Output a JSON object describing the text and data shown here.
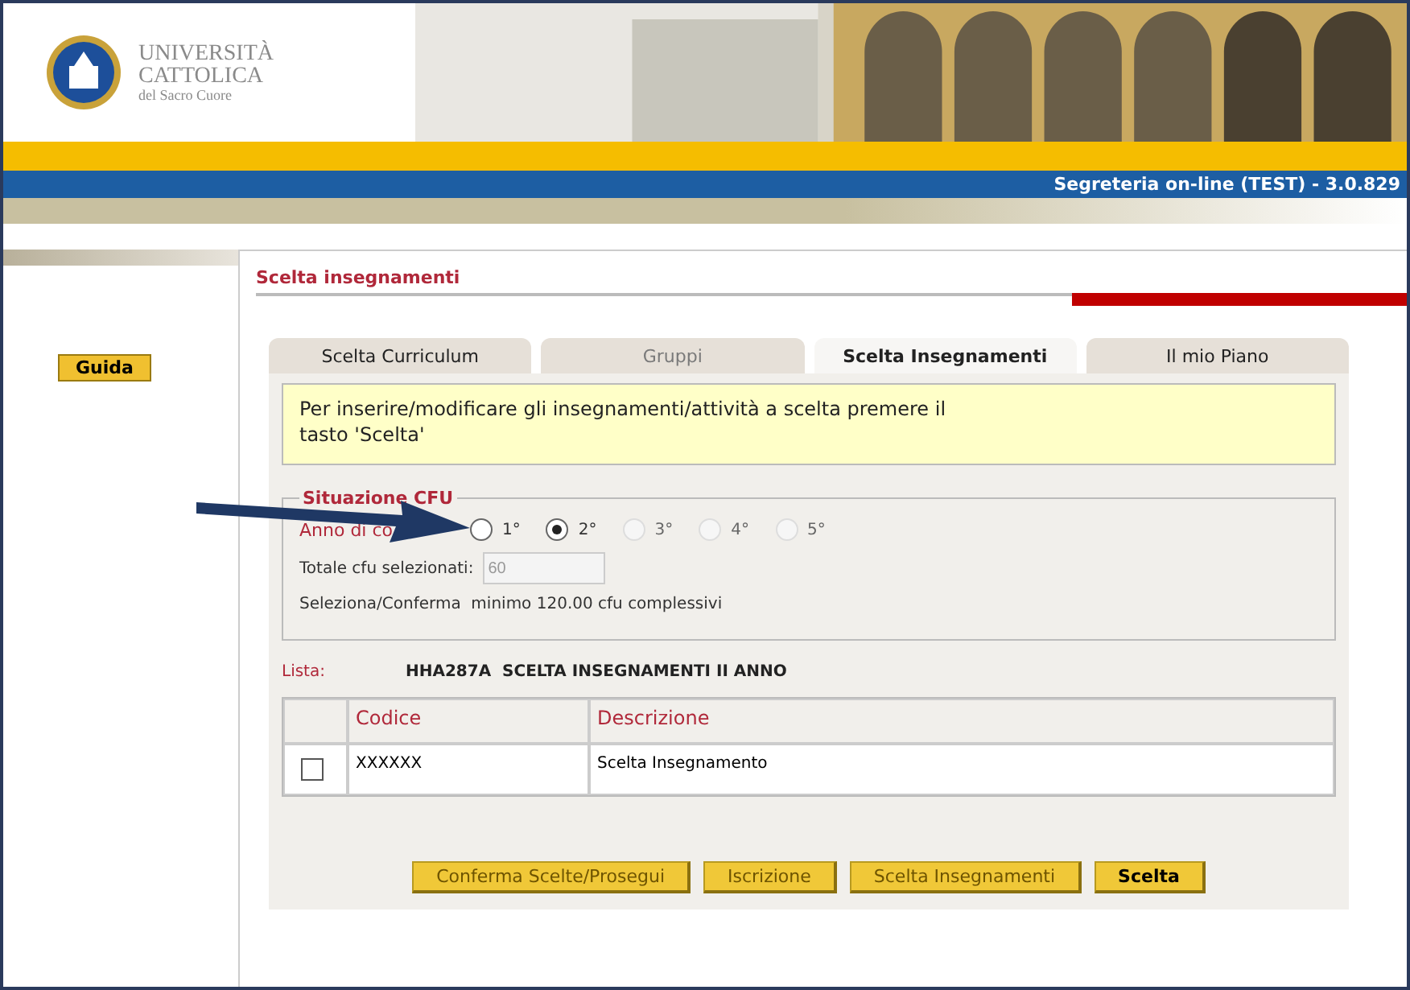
{
  "header": {
    "brand": [
      "UNIVERSITÀ",
      "CATTOLICA",
      "del Sacro Cuore"
    ],
    "app_title": "Segreteria on-line (TEST) - 3.0.829"
  },
  "sidebar": {
    "guide_button": "Guida"
  },
  "page": {
    "title": "Scelta insegnamenti",
    "user_redacted": true
  },
  "tabs": [
    {
      "label": "Scelta Curriculum",
      "selected": false,
      "disabled": false
    },
    {
      "label": "Gruppi",
      "selected": false,
      "disabled": true
    },
    {
      "label": "Scelta Insegnamenti",
      "selected": true,
      "disabled": false
    },
    {
      "label": "Il mio Piano",
      "selected": false,
      "disabled": false
    }
  ],
  "info": "Per inserire/modificare gli insegnamenti/attività a scelta premere il tasto 'Scelta'",
  "cfu": {
    "legend": "Situazione CFU",
    "year_label": "Anno di co",
    "years": [
      {
        "label": "1°",
        "selected": false,
        "disabled": false
      },
      {
        "label": "2°",
        "selected": true,
        "disabled": false
      },
      {
        "label": "3°",
        "selected": false,
        "disabled": true
      },
      {
        "label": "4°",
        "selected": false,
        "disabled": true
      },
      {
        "label": "5°",
        "selected": false,
        "disabled": true
      }
    ],
    "total_label": "Totale cfu selezionati:",
    "total_value": "60",
    "note": "Seleziona/Conferma  minimo 120.00 cfu complessivi"
  },
  "list": {
    "label": "Lista:",
    "value": "HHA287A  SCELTA INSEGNAMENTI II ANNO"
  },
  "table": {
    "columns": [
      "Codice",
      "Descrizione"
    ],
    "rows": [
      {
        "checked": false,
        "cells": [
          "XXXXXX",
          "Scelta Insegnamento"
        ]
      }
    ]
  },
  "buttons": [
    {
      "label": "Conferma Scelte/Prosegui",
      "disabled": true
    },
    {
      "label": "Iscrizione",
      "disabled": true
    },
    {
      "label": "Scelta Insegnamenti",
      "disabled": true
    },
    {
      "label": "Scelta",
      "disabled": false
    }
  ]
}
